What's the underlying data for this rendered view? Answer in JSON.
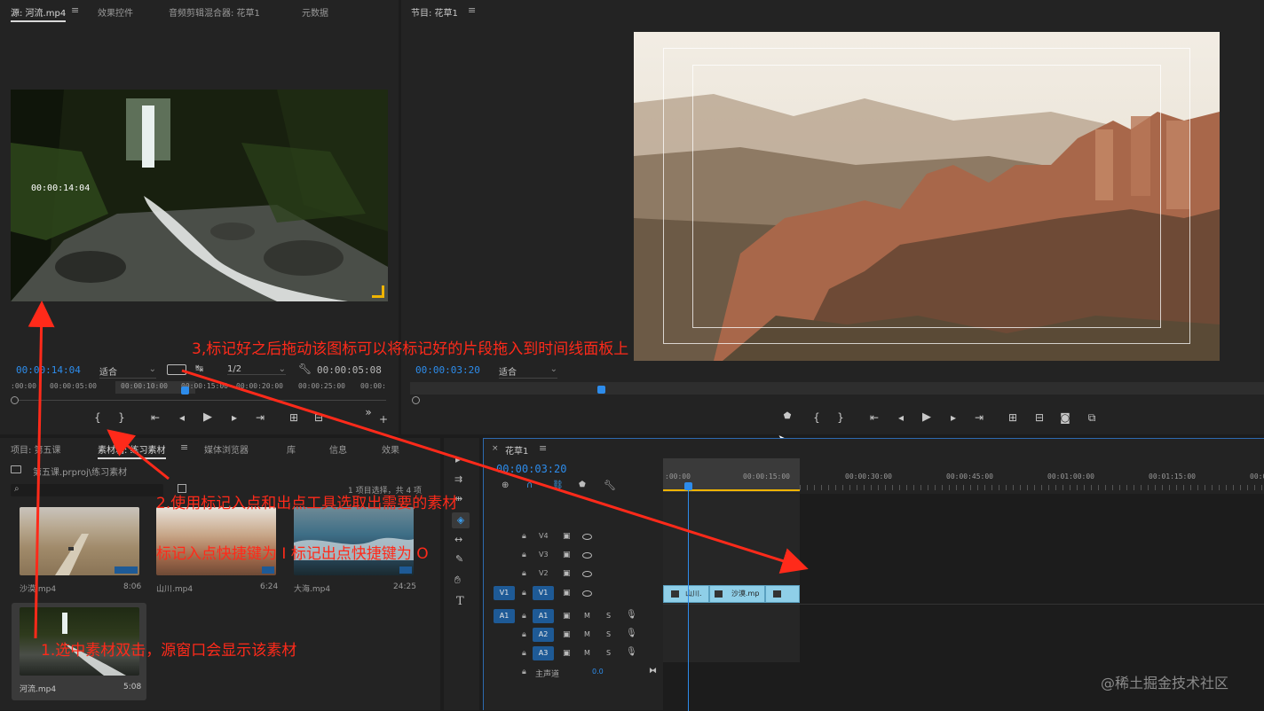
{
  "source_panel": {
    "tabs": [
      "源: 河流.mp4",
      "效果控件",
      "音频剪辑混合器: 花草1",
      "元数据"
    ],
    "overlay_timecode": "00:00:14:04",
    "current_time": "00:00:14:04",
    "fit_label": "适合",
    "resolution_label": "1/2",
    "duration": "00:00:05:08",
    "ruler_ticks": [
      ":00:00",
      "00:00:05:00",
      "00:00:10:00",
      "00:00:15:00",
      "00:00:20:00",
      "00:00:25:00",
      "00:00:"
    ]
  },
  "program_panel": {
    "tab": "节目: 花草1",
    "current_time": "00:00:03:20",
    "fit_label": "适合"
  },
  "project_panel": {
    "tabs": [
      "项目: 第五课",
      "素材箱: 练习素材",
      "媒体浏览器",
      "库",
      "信息",
      "效果"
    ],
    "path": "第五课.prproj\\练习素材",
    "selection_info": "1 项目选择，共 4 项",
    "clips": [
      {
        "name": "沙漠.mp4",
        "duration": "8:06"
      },
      {
        "name": "山川.mp4",
        "duration": "6:24"
      },
      {
        "name": "大海.mp4",
        "duration": "24:25"
      },
      {
        "name": "河流.mp4",
        "duration": "5:08"
      }
    ]
  },
  "timeline": {
    "tab": "花草1",
    "current_time": "00:00:03:20",
    "ruler_ticks": [
      ":00:00",
      "00:00:15:00",
      "00:00:30:00",
      "00:00:45:00",
      "00:01:00:00",
      "00:01:15:00",
      "00:01:"
    ],
    "video_tracks": [
      "V4",
      "V3",
      "V2",
      "V1"
    ],
    "audio_tracks": [
      "A1",
      "A2",
      "A3"
    ],
    "source_v": "V1",
    "source_a": "A1",
    "mute_label": "M",
    "solo_label": "S",
    "master_label": "主声道",
    "master_value": "0.0",
    "clips": [
      "山川.",
      "沙漠.mp",
      ""
    ]
  },
  "annotations": {
    "step1": "1.选中素材双击，源窗口会显示该素材",
    "step2": "2.使用标记入点和出点工具选取出需要的素材",
    "step2_note": "标记入点快捷键为 I 标记出点快捷键为 O",
    "step3": "3,标记好之后拖动该图标可以将标记好的片段拖入到时间线面板上"
  },
  "watermark": "@稀土掘金技术社区",
  "colors": {
    "accent_blue": "#2d8ceb",
    "annotation_red": "#ff2a1a",
    "clip_blue": "#8fcfe8",
    "track_blue": "#1e5a96"
  }
}
